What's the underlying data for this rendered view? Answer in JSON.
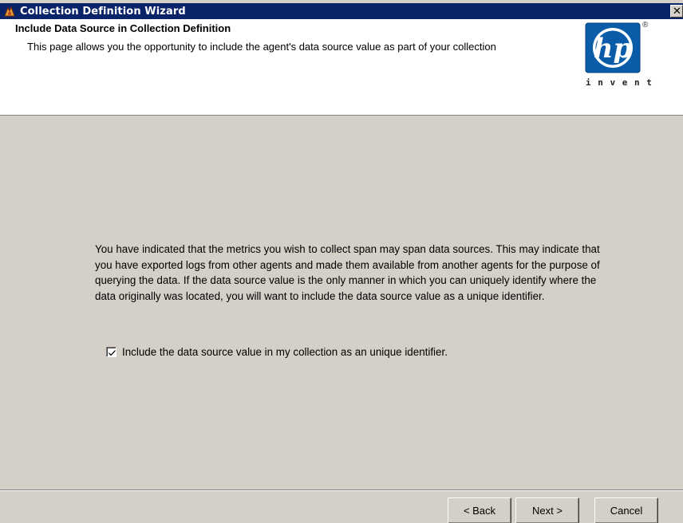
{
  "window": {
    "title": "Collection Definition Wizard",
    "close_label": "✕"
  },
  "header": {
    "title": "Include Data Source in Collection Definition",
    "description": "This page allows you the opportunity to include the agent's data source value as part of your collection",
    "logo": {
      "brand": "hp",
      "tagline": "i n v e n t",
      "registered": "®"
    }
  },
  "main": {
    "explanation": "You have indicated that the metrics you wish to collect span may span data sources. This may indicate that you have exported logs from other agents and made them available from another agents for the purpose of querying the data. If the data source value is the only manner in which you can uniquely identify where the data originally was located, you will want to include the data source value as a unique identifier.",
    "checkbox": {
      "label": "Include the data source value in my collection as an unique identifier.",
      "checked": true
    }
  },
  "buttons": {
    "back": "< Back",
    "next": "Next >",
    "cancel": "Cancel"
  },
  "colors": {
    "titlebar": "#0a246a",
    "dialog_bg": "#d4d0c8",
    "hp_blue": "#0a5aa8"
  }
}
